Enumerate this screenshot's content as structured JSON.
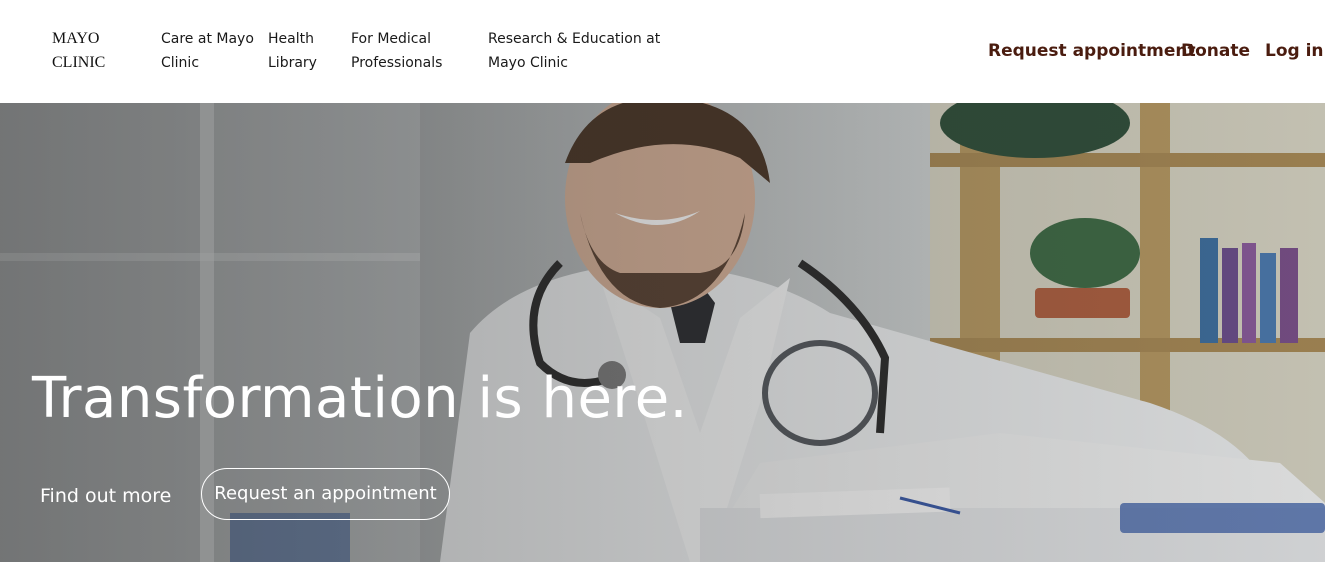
{
  "header": {
    "logo": "MAYO CLINIC",
    "nav": [
      {
        "label": "Care at Mayo Clinic"
      },
      {
        "label": "Health Library"
      },
      {
        "label": "For Medical Professionals"
      },
      {
        "label": "Research & Education at Mayo Clinic"
      }
    ],
    "utility": {
      "request_appointment": "Request appointment",
      "donate": "Donate",
      "login": "Log in"
    },
    "accent_color": "#4a1c0f"
  },
  "hero": {
    "headline": "Transformation is here.",
    "find_out_more": "Find out more",
    "request_appointment": "Request an appointment",
    "image": "doctor-photo"
  }
}
